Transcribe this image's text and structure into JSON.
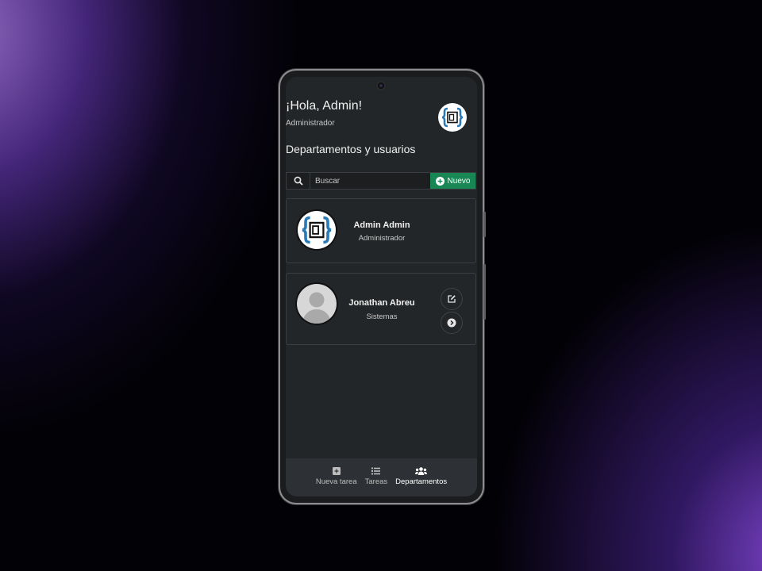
{
  "header": {
    "greeting": "¡Hola, Admin!",
    "role": "Administrador",
    "logo_icon": "brackets-logo-icon"
  },
  "section": {
    "title": "Departamentos y usuarios"
  },
  "search": {
    "placeholder": "Buscar",
    "value": "",
    "new_label": "Nuevo"
  },
  "users": [
    {
      "name": "Admin Admin",
      "department": "Administrador",
      "avatar": "brackets-logo-icon"
    },
    {
      "name": "Jonathan Abreu",
      "department": "Sistemas",
      "avatar": "default-user-avatar"
    }
  ],
  "nav": [
    {
      "label": "Nueva tarea",
      "icon": "plus-square-icon",
      "active": false
    },
    {
      "label": "Tareas",
      "icon": "list-icon",
      "active": false
    },
    {
      "label": "Departamentos",
      "icon": "users-icon",
      "active": true
    }
  ],
  "colors": {
    "accent_green": "#198754",
    "screen_bg": "#232628",
    "logo_blue": "#2a7ab8"
  }
}
